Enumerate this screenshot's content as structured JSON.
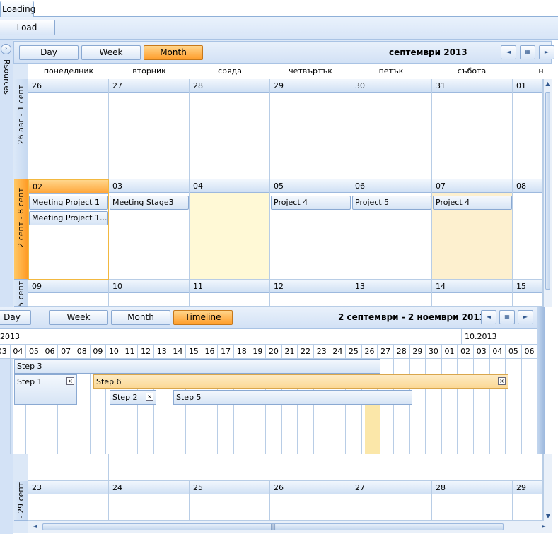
{
  "tab": {
    "label": "Loading"
  },
  "toolbar": {
    "load_label": "Load"
  },
  "resources_label": "Rsources",
  "scheduler": {
    "views": [
      "Day",
      "Week",
      "Month"
    ],
    "active_view": "Month",
    "period_title": "септември 2013",
    "weekdays": [
      "понеделник",
      "вторник",
      "сряда",
      "четвъртък",
      "петък",
      "събота",
      "н"
    ],
    "weeks": [
      {
        "label": "26 авг - 1 септ",
        "days": [
          "26",
          "27",
          "28",
          "29",
          "30",
          "31",
          "01"
        ]
      },
      {
        "label": "2 септ - 8 септ",
        "days": [
          "02",
          "03",
          "04",
          "05",
          "06",
          "07",
          "08"
        ]
      },
      {
        "label": "5 септ",
        "days": [
          "09",
          "10",
          "11",
          "12",
          "13",
          "14",
          "15"
        ]
      },
      {
        "label": "- 29 септ",
        "days": [
          "23",
          "24",
          "25",
          "26",
          "27",
          "28",
          "29"
        ]
      }
    ],
    "appointments": [
      "Meeting Project 1",
      "Meeting Project 1...",
      "Meeting Stage3",
      "Project 4",
      "Project 5",
      "Project 4"
    ]
  },
  "timeline": {
    "views": [
      "Day",
      "Week",
      "Month",
      "Timeline"
    ],
    "active_view": "Timeline",
    "period_title": "2 септември - 2 ноември 2013",
    "month_labels": [
      "2013",
      "10.2013"
    ],
    "days": [
      "03",
      "04",
      "05",
      "06",
      "07",
      "08",
      "09",
      "10",
      "11",
      "12",
      "13",
      "14",
      "15",
      "16",
      "17",
      "18",
      "19",
      "20",
      "21",
      "22",
      "23",
      "24",
      "25",
      "26",
      "27",
      "28",
      "29",
      "30",
      "01",
      "02",
      "03",
      "04",
      "05",
      "06"
    ],
    "tasks": [
      "Step 3",
      "Step 1",
      "Step 6",
      "Step 2",
      "Step 5"
    ]
  },
  "icons": {
    "close": "×",
    "prev": "◄",
    "next": "►",
    "calendar": "▦",
    "expand": "›"
  }
}
